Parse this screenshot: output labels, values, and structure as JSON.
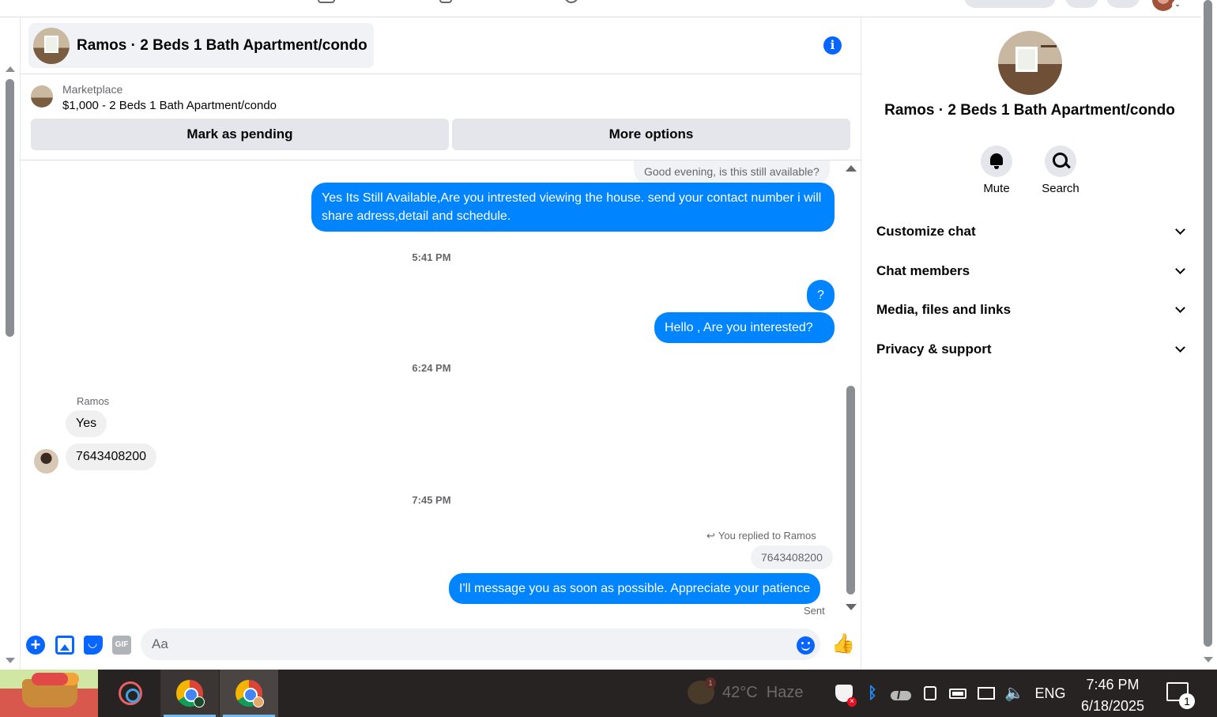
{
  "chat": {
    "title": "Ramos · 2 Beds 1 Bath Apartment/condo",
    "marketplace_label": "Marketplace",
    "listing": "$1,000 - 2 Beds 1 Bath Apartment/condo",
    "mark_pending": "Mark as pending",
    "more_options": "More options",
    "messages": {
      "m0": "Good evening, is this still available?",
      "m1": "Yes Its Still Available,Are you intrested viewing the house. send your contact number i will share adress,detail and schedule.",
      "t1": "5:41 PM",
      "m2": "?",
      "m3": "Hello , Are you  interested?",
      "t2": "6:24 PM",
      "sender": "Ramos",
      "m4": "Yes",
      "m5": "7643408200",
      "t3": "7:45 PM",
      "reply_note": "You replied to Ramos",
      "reply_quote": "7643408200",
      "m6": "I'll message you as soon as possible. Appreciate your patience",
      "status": "Sent"
    },
    "composer": {
      "placeholder": "Aa",
      "gif_label": "GIF"
    }
  },
  "info_panel": {
    "name": "Ramos · 2 Beds 1 Bath Apartment/condo",
    "actions": {
      "mute": "Mute",
      "search": "Search"
    },
    "sections": [
      "Customize chat",
      "Chat members",
      "Media, files and links",
      "Privacy & support"
    ]
  },
  "taskbar": {
    "weather": "42°C  Haze",
    "weather_badge": "1",
    "language": "ENG",
    "time": "7:46 PM",
    "date": "6/18/2025",
    "notification_count": "1"
  },
  "colors": {
    "accent": "#0866ff",
    "outgoing_bubble": "#0084ff",
    "incoming_bubble": "#f0f0f0",
    "taskbar": "#272322"
  }
}
